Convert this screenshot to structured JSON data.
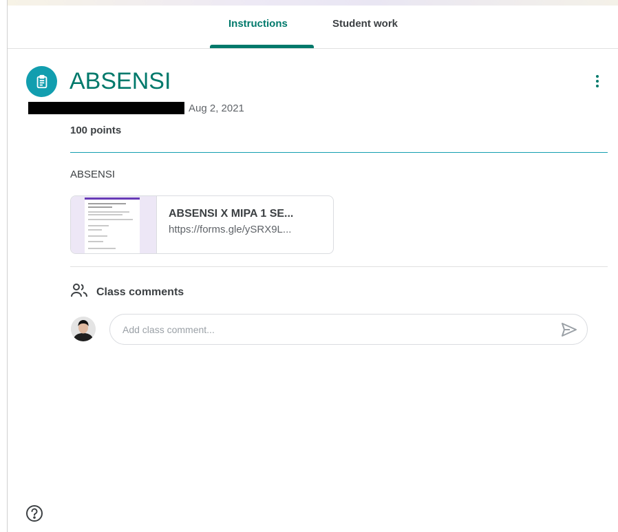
{
  "tabs": [
    {
      "label": "Instructions",
      "active": true
    },
    {
      "label": "Student work",
      "active": false
    }
  ],
  "assignment": {
    "icon": "assignment-icon",
    "title": "ABSENSI",
    "date": "Aug 2, 2021",
    "points": "100 points",
    "description": "ABSENSI"
  },
  "attachment": {
    "title": "ABSENSI X MIPA 1 SE...",
    "url": "https://forms.gle/ySRX9L..."
  },
  "comments": {
    "heading": "Class comments",
    "placeholder": "Add class comment..."
  },
  "icons": {
    "more": "more-vert-icon",
    "people": "people-icon",
    "send": "send-icon",
    "help": "help-icon"
  },
  "colors": {
    "accent": "#00796b",
    "icon_bg": "#129eaf"
  }
}
